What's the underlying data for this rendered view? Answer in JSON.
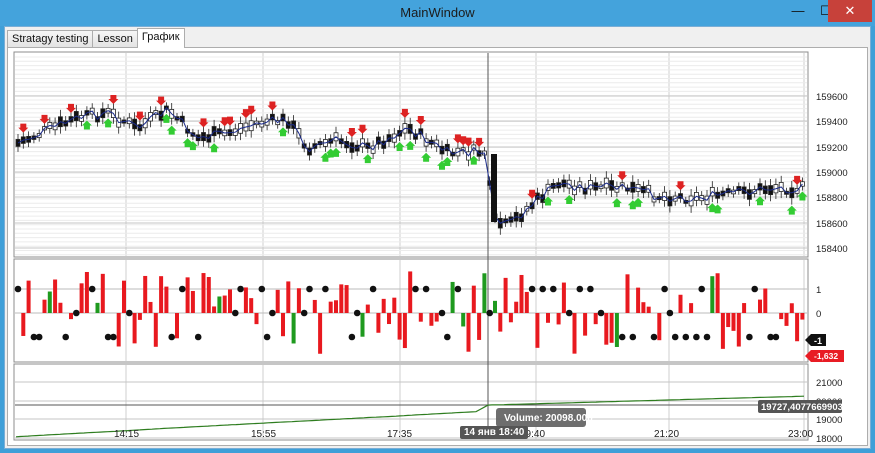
{
  "window": {
    "title": "MainWindow",
    "minimize": "—",
    "maximize": "☐",
    "close": "✕"
  },
  "tabs": [
    {
      "label": "Stratagy testing",
      "active": false
    },
    {
      "label": "Lesson",
      "active": false
    },
    {
      "label": "График",
      "active": true
    }
  ],
  "price_axis": [
    "159600",
    "159400",
    "159200",
    "159000",
    "158800",
    "158600",
    "158400"
  ],
  "signal_axis": [
    "1",
    "0"
  ],
  "signal_badges": {
    "current": "-1",
    "value": "-1,632"
  },
  "equity_axis": [
    "21000",
    "20000",
    "19000",
    "18000"
  ],
  "equity_badge": "19727,4077669903",
  "time_axis": [
    "14:15",
    "15:55",
    "17:35",
    "19:40",
    "21:20",
    "23:00"
  ],
  "cursor_time": "14 янв 18:40",
  "tooltip": "Volume: 20098.000",
  "colors": {
    "up_arrow": "#33cc33",
    "down_arrow": "#dd2222",
    "bar_red": "#e8191f",
    "bar_green": "#1f9a1f",
    "equity_line": "#2e7d1f",
    "badge_red": "#e81c24"
  }
}
